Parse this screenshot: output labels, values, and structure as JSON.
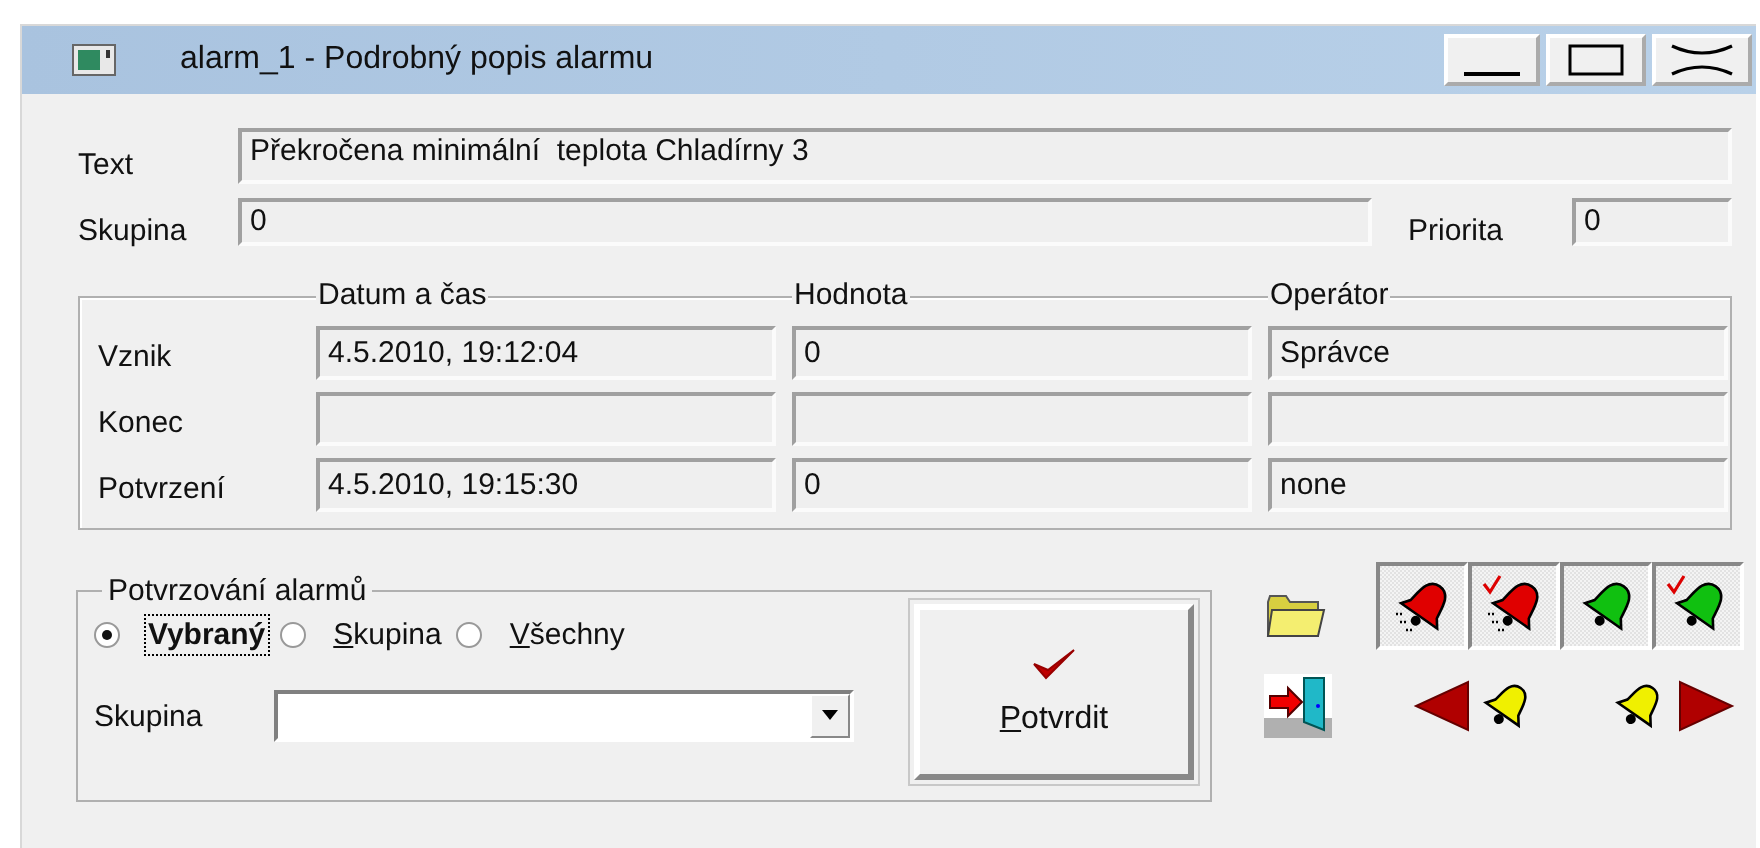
{
  "window": {
    "title": "alarm_1 - Podrobný popis alarmu"
  },
  "text": {
    "label": "Text",
    "value": "Překročena minimální  teplota Chladírny 3"
  },
  "group": {
    "label": "Skupina",
    "value": "0"
  },
  "priority": {
    "label": "Priorita",
    "value": "0"
  },
  "events": {
    "columns": [
      "Datum a čas",
      "Hodnota",
      "Operátor"
    ],
    "rows": [
      {
        "label": "Vznik",
        "date": "4.5.2010, 19:12:04",
        "value": "0",
        "operator": "Správce"
      },
      {
        "label": "Konec"
      },
      {
        "label": "Potvrzení",
        "date": "4.5.2010, 19:15:30",
        "value": "0",
        "operator": "none"
      }
    ]
  },
  "confirmation": {
    "title": "Potvrzování alarmů",
    "radios": [
      {
        "label": "Vybraný",
        "selected": true,
        "focused": true,
        "mnemonic": false
      },
      {
        "label": "Skupina",
        "selected": false,
        "focused": false,
        "mnemonic": true
      },
      {
        "label": "Všechny",
        "selected": false,
        "focused": false,
        "mnemonic": true
      }
    ],
    "group_label": "Skupina",
    "confirm_button": {
      "label": "Potvrdit",
      "mnemonic": true
    }
  },
  "bell_filters": [
    {
      "kind": "red",
      "pressed": true
    },
    {
      "kind": "red_checked",
      "pressed": true
    },
    {
      "kind": "green",
      "pressed": true
    },
    {
      "kind": "green_checked",
      "pressed": true
    }
  ]
}
